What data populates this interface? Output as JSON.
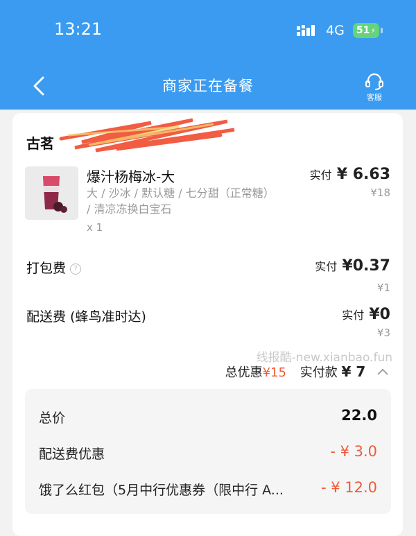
{
  "status_bar": {
    "time": "13:21",
    "network": "4G",
    "battery": "51"
  },
  "header": {
    "title": "商家正在备餐",
    "support_label": "客服"
  },
  "shop": {
    "name_visible": "古茗"
  },
  "item": {
    "name": "爆汁杨梅冰-大",
    "spec_line1": "大 / 沙冰 / 默认糖 / 七分甜（正常糖）",
    "spec_line2": "/ 清凉冻换白宝石",
    "quantity": "x 1",
    "paid_label": "实付",
    "paid_amount": "¥ 6.63",
    "original_price": "¥18"
  },
  "packing_fee": {
    "label": "打包费",
    "paid_label": "实付",
    "paid_amount": "¥0.37",
    "original_price": "¥1"
  },
  "delivery_fee": {
    "label": "配送费 (蜂鸟准时达)",
    "paid_label": "实付",
    "paid_amount": "¥0",
    "original_price": "¥3"
  },
  "watermark": "线报酷-new.xianbao.fun",
  "totals": {
    "discount_label": "总优惠",
    "discount_amount": "¥15",
    "paid_label": "实付款",
    "paid_amount": "¥ 7"
  },
  "summary": {
    "rows": [
      {
        "label": "总价",
        "value": "22.0"
      },
      {
        "label": "配送费优惠",
        "value": "- ¥ 3.0"
      },
      {
        "label": "饿了么红包（5月中行优惠券（限中行 A...",
        "value": "- ¥ 12.0"
      }
    ]
  },
  "colors": {
    "header_blue": "#3b9bf0",
    "discount_red": "#f05a3a",
    "battery_green": "#63d47a"
  }
}
